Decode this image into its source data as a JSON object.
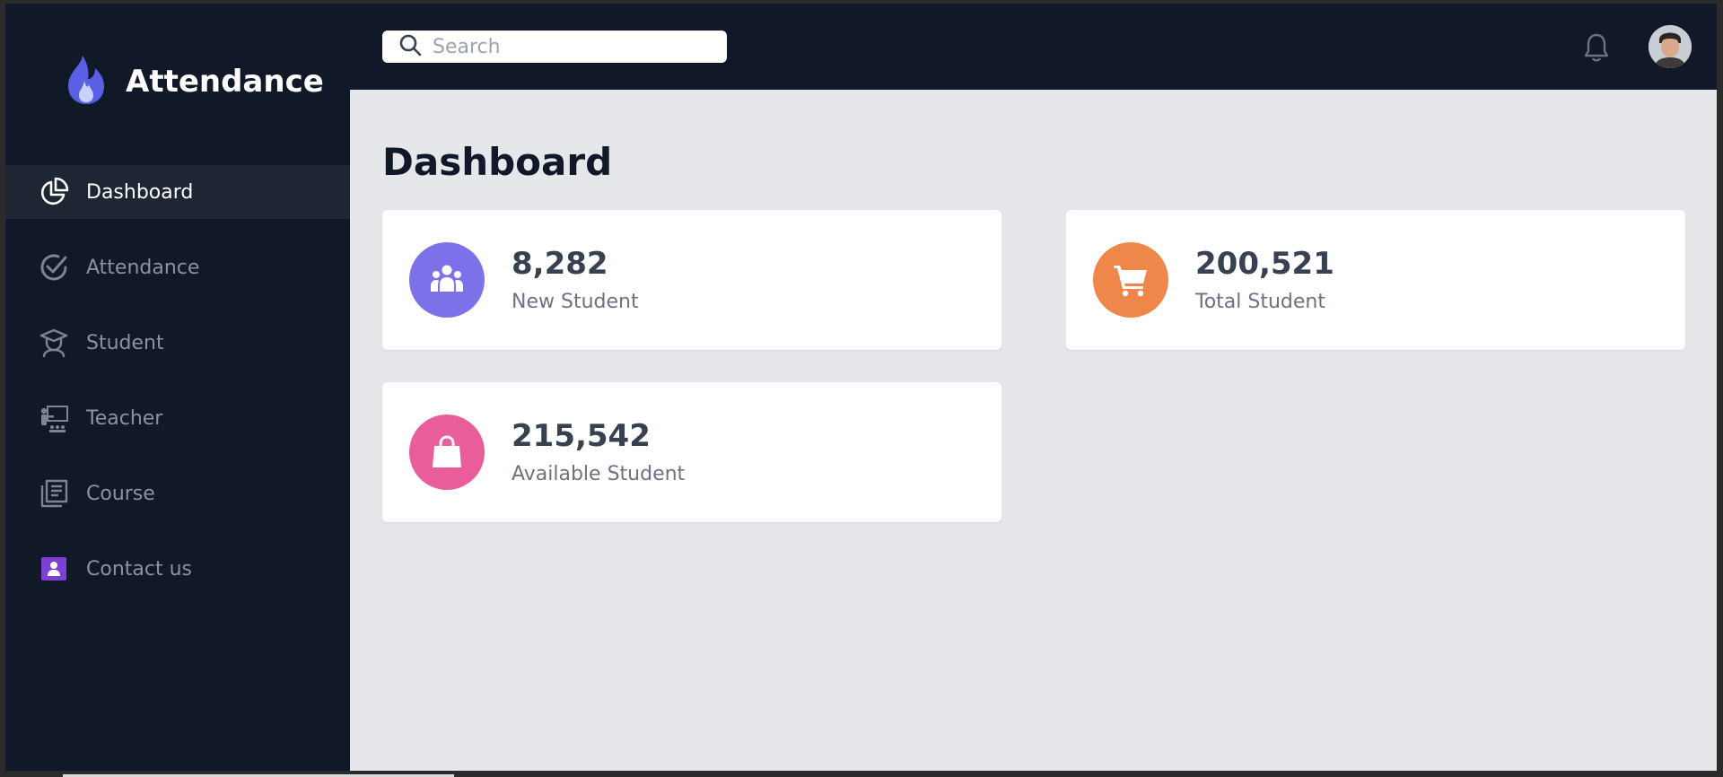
{
  "app": {
    "title": "Attendance"
  },
  "sidebar": {
    "items": [
      {
        "label": "Dashboard",
        "icon": "pie-chart-icon",
        "active": true
      },
      {
        "label": "Attendance",
        "icon": "check-circle-icon",
        "active": false
      },
      {
        "label": "Student",
        "icon": "graduation-cap-icon",
        "active": false
      },
      {
        "label": "Teacher",
        "icon": "teacher-board-icon",
        "active": false
      },
      {
        "label": "Course",
        "icon": "newspaper-icon",
        "active": false
      },
      {
        "label": "Contact us",
        "icon": "contact-card-icon",
        "active": false
      }
    ]
  },
  "header": {
    "search": {
      "placeholder": "Search",
      "value": ""
    }
  },
  "main": {
    "title": "Dashboard",
    "cards": [
      {
        "value": "8,282",
        "label": "New Student",
        "icon": "users-group-icon",
        "color": "#7c71e8"
      },
      {
        "value": "200,521",
        "label": "Total Student",
        "icon": "shopping-cart-icon",
        "color": "#f0874a"
      },
      {
        "value": "215,542",
        "label": "Available Student",
        "icon": "shopping-bag-icon",
        "color": "#e85d9a"
      }
    ]
  },
  "colors": {
    "sidebar_bg": "#111827",
    "main_bg": "#e5e7eb",
    "brand_accent": "#6366f1"
  }
}
